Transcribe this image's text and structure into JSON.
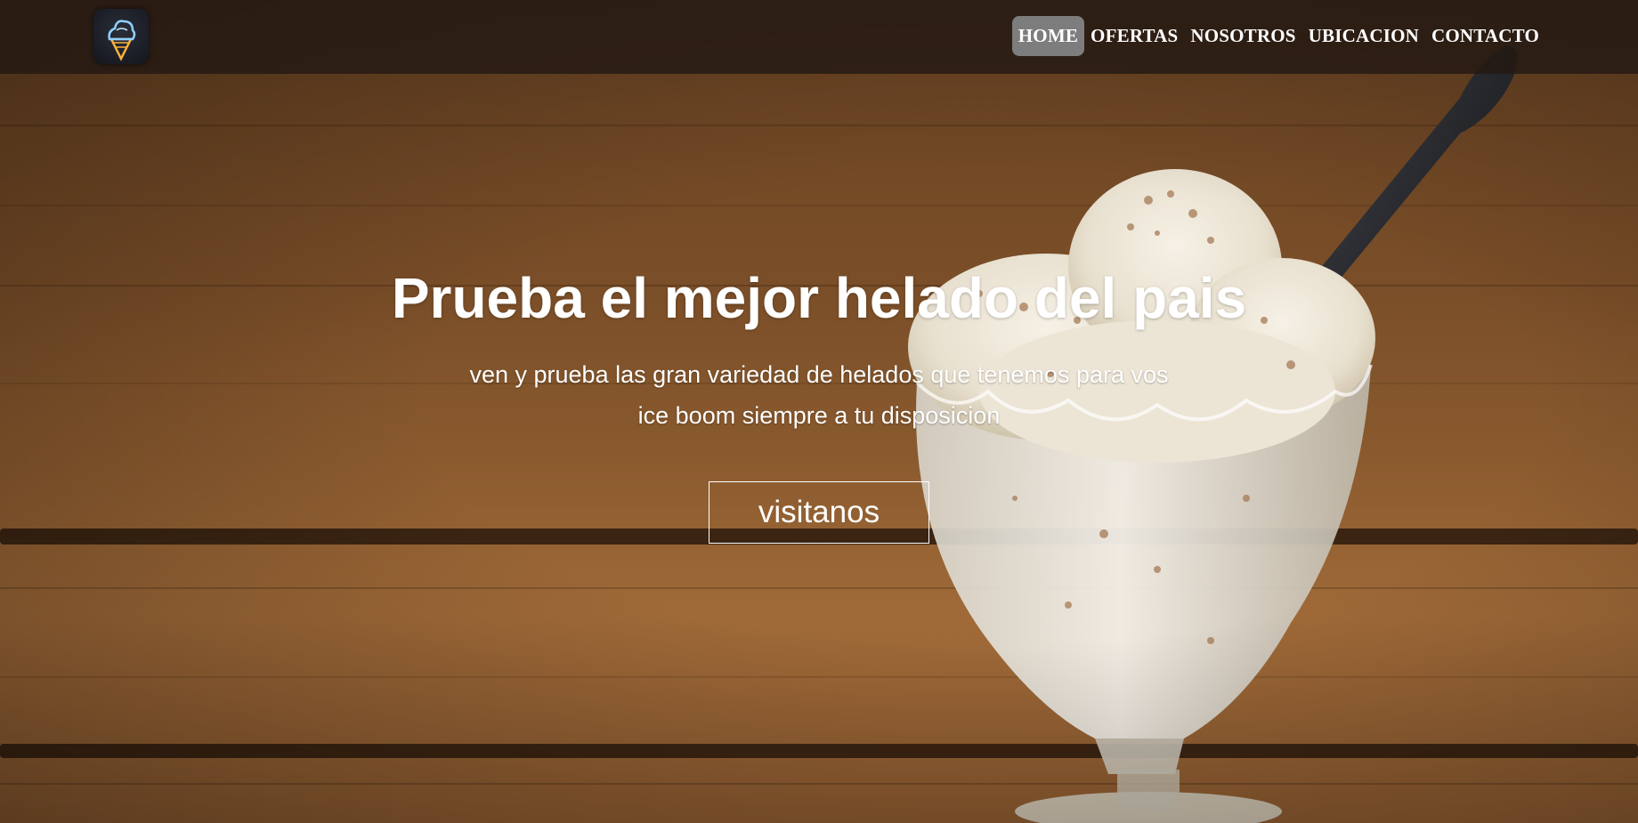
{
  "header": {
    "logo_icon": "ice-cream-cone-icon",
    "nav": [
      {
        "label": "HOME",
        "active": true
      },
      {
        "label": "OFERTAS",
        "active": false
      },
      {
        "label": "NOSOTROS",
        "active": false
      },
      {
        "label": "UBICACION",
        "active": false
      },
      {
        "label": "CONTACTO",
        "active": false
      }
    ]
  },
  "hero": {
    "title": "Prueba el mejor helado del pais",
    "subtitle_line1": "ven y prueba las gran variedad de helados que tenemos para vos",
    "subtitle_line2": "ice boom siempre a tu disposicion",
    "cta_label": "visitanos",
    "background_image": "ice-cream-sundae-glass-on-wooden-table"
  },
  "colors": {
    "navbar_bg": "#231912",
    "active_tab_bg": "#7d7d7d",
    "text": "#ffffff",
    "wood": "#8a5a2e"
  }
}
